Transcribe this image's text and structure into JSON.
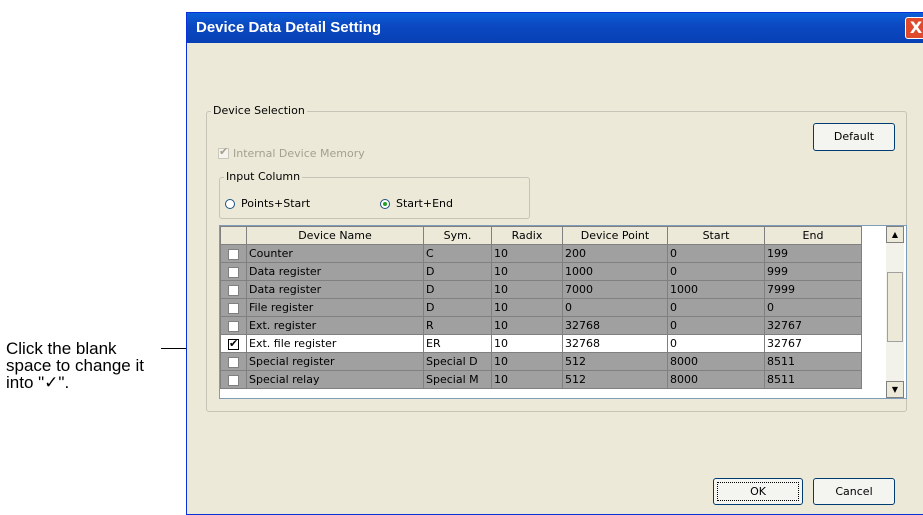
{
  "callout": {
    "text": "Click the blank space to change it into \"✓\"."
  },
  "dialog": {
    "title": "Device Data Detail Setting",
    "close_glyph": "X",
    "device_selection_label": "Device Selection",
    "internal_memory_label": "Internal Device Memory",
    "default_label": "Default",
    "input_column_label": "Input Column",
    "radio_points_start": "Points+Start",
    "radio_start_end": "Start+End",
    "radio_selected": "Start+End",
    "ok_label": "OK",
    "cancel_label": "Cancel"
  },
  "table": {
    "columns": [
      "",
      "Device Name",
      "Sym.",
      "Radix",
      "Device Point",
      "Start",
      "End"
    ],
    "rows": [
      {
        "checked": false,
        "name": "Counter",
        "sym": "C",
        "radix": "10",
        "point": "200",
        "start": "0",
        "end": "199"
      },
      {
        "checked": false,
        "name": "Data register",
        "sym": "D",
        "radix": "10",
        "point": "1000",
        "start": "0",
        "end": "999"
      },
      {
        "checked": false,
        "name": "Data register",
        "sym": "D",
        "radix": "10",
        "point": "7000",
        "start": "1000",
        "end": "7999"
      },
      {
        "checked": false,
        "name": "File register",
        "sym": "D",
        "radix": "10",
        "point": "0",
        "start": "0",
        "end": "0"
      },
      {
        "checked": false,
        "name": "Ext. register",
        "sym": "R",
        "radix": "10",
        "point": "32768",
        "start": "0",
        "end": "32767"
      },
      {
        "checked": true,
        "name": "Ext. file register",
        "sym": "ER",
        "radix": "10",
        "point": "32768",
        "start": "0",
        "end": "32767"
      },
      {
        "checked": false,
        "name": "Special register",
        "sym": "Special D",
        "radix": "10",
        "point": "512",
        "start": "8000",
        "end": "8511"
      },
      {
        "checked": false,
        "name": "Special relay",
        "sym": "Special M",
        "radix": "10",
        "point": "512",
        "start": "8000",
        "end": "8511"
      }
    ],
    "selected_row": 5
  },
  "icons": {
    "scroll_up": "triangle-up-icon",
    "scroll_down": "triangle-down-icon",
    "check": "check-icon"
  },
  "colors": {
    "titlebar": "#0a5fd8",
    "dialog_bg": "#ece9d8",
    "row_bg": "#a0a0a0"
  }
}
